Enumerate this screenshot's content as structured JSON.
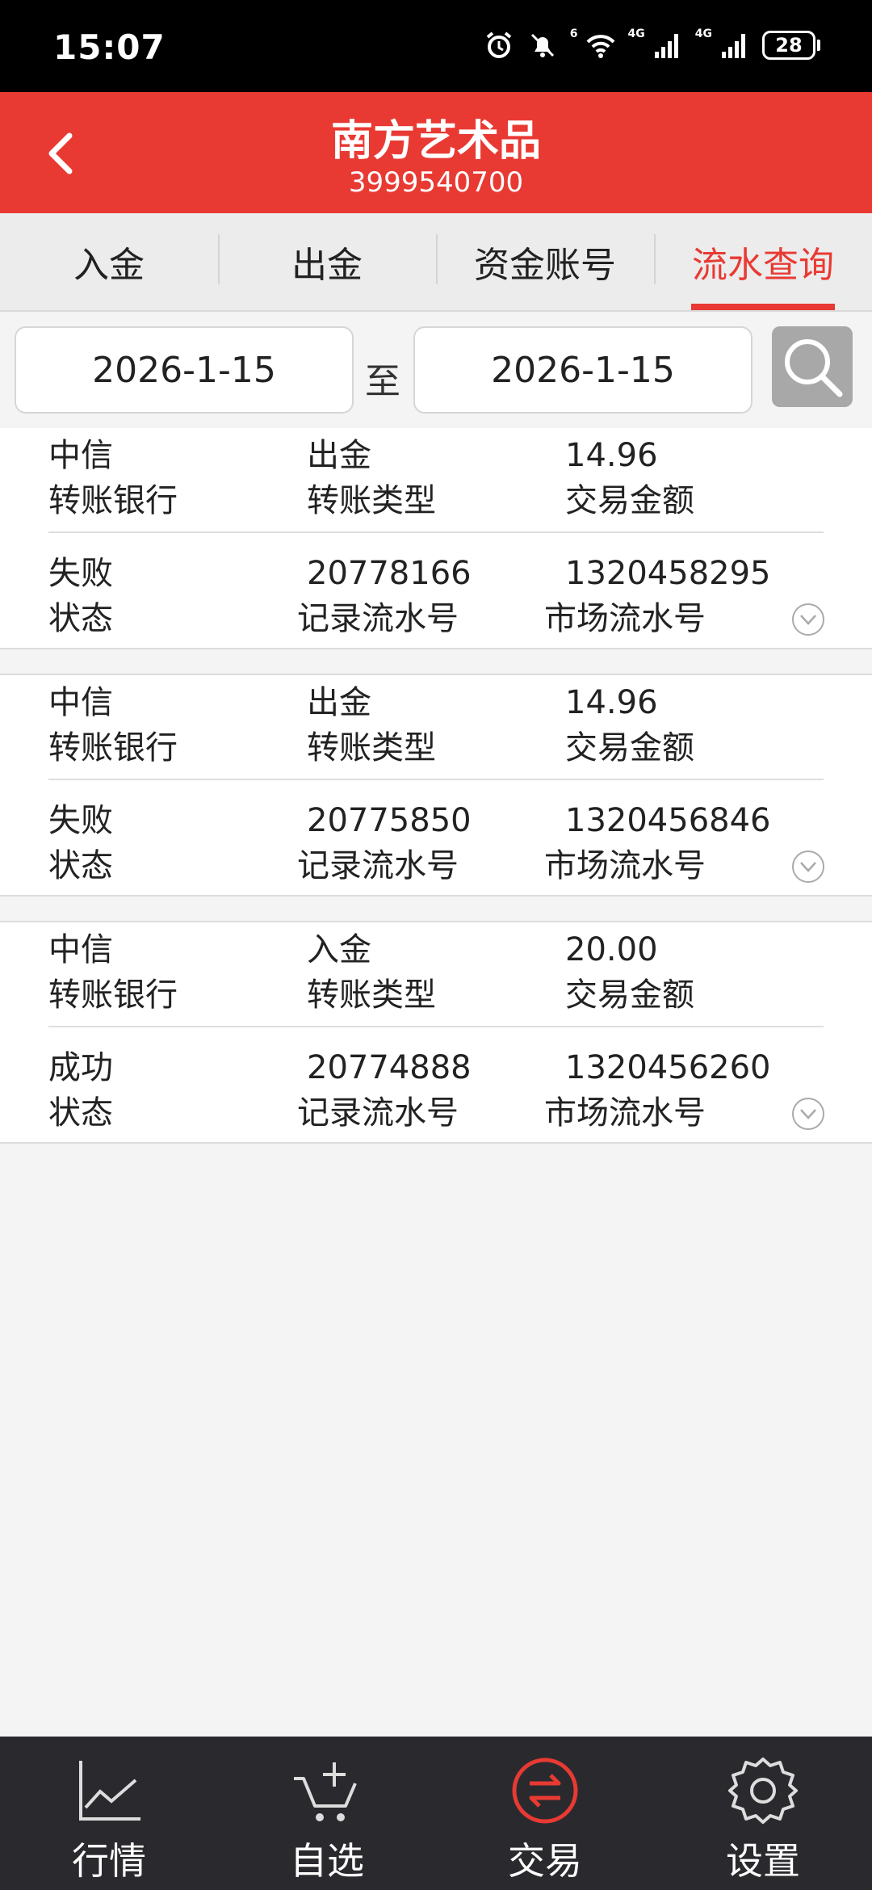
{
  "status_bar": {
    "time": "15:07",
    "signal1_label": "6",
    "signal2_label": "4G",
    "signal3_label": "4G",
    "battery": "28"
  },
  "header": {
    "title": "南方艺术品",
    "subtitle": "3999540700",
    "back_icon": "chevron-left-icon"
  },
  "tabs": [
    {
      "label": "入金",
      "active": false
    },
    {
      "label": "出金",
      "active": false
    },
    {
      "label": "资金账号",
      "active": false
    },
    {
      "label": "流水查询",
      "active": true
    }
  ],
  "filter": {
    "date_from": "2026-1-15",
    "to_label": "至",
    "date_to": "2026-1-15",
    "search_icon": "search-icon"
  },
  "labels": {
    "bank": "转账银行",
    "type": "转账类型",
    "amount": "交易金额",
    "status": "状态",
    "record_no": "记录流水号",
    "market_no": "市场流水号"
  },
  "records": [
    {
      "bank": "中信",
      "type": "出金",
      "amount": "14.96",
      "status": "失败",
      "record_no": "20778166",
      "market_no": "1320458295"
    },
    {
      "bank": "中信",
      "type": "出金",
      "amount": "14.96",
      "status": "失败",
      "record_no": "20775850",
      "market_no": "1320456846"
    },
    {
      "bank": "中信",
      "type": "入金",
      "amount": "20.00",
      "status": "成功",
      "record_no": "20774888",
      "market_no": "1320456260"
    }
  ],
  "bottom_nav": [
    {
      "label": "行情",
      "icon": "line-chart-icon",
      "active": false
    },
    {
      "label": "自选",
      "icon": "cart-add-icon",
      "active": false
    },
    {
      "label": "交易",
      "icon": "exchange-icon",
      "active": true
    },
    {
      "label": "设置",
      "icon": "gear-icon",
      "active": false
    }
  ],
  "colors": {
    "brand_red": "#e83a33",
    "nav_bg": "#2a2a2e"
  }
}
